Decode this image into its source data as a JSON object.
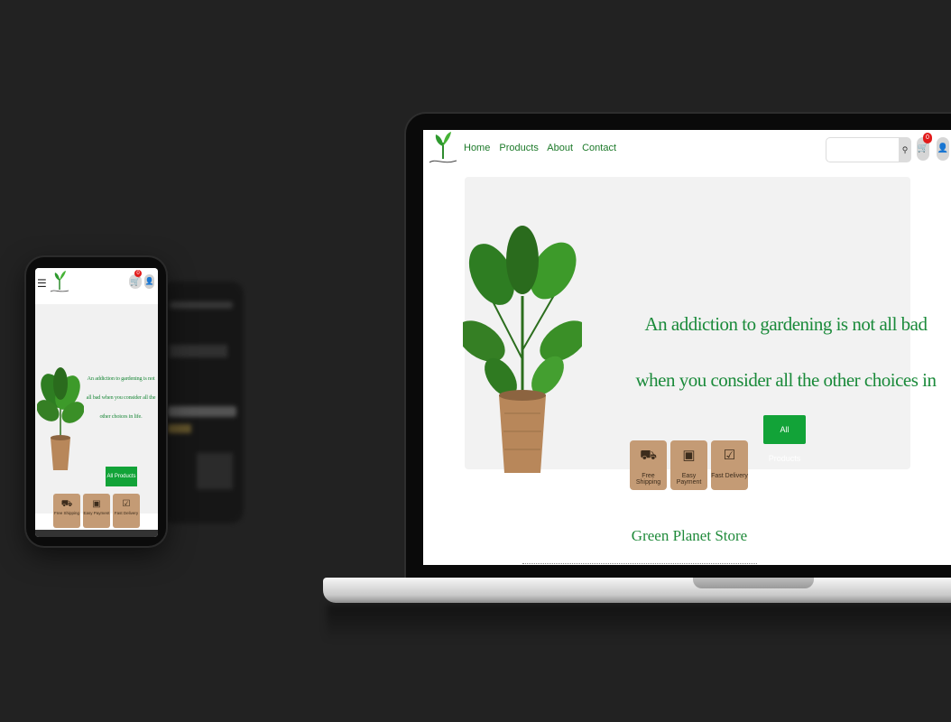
{
  "site": {
    "nav": [
      "Home",
      "Products",
      "About",
      "Contact"
    ],
    "search_placeholder": "",
    "cart_count": "0",
    "hero_quote": "An addiction to gardening is not all bad when you consider all the other choices in life.",
    "cta": "All Products",
    "features": [
      {
        "label": "Free Shipping",
        "icon": "truck-icon"
      },
      {
        "label": "Easy Payment",
        "icon": "wallet-icon"
      },
      {
        "label": "Fast Delivery",
        "icon": "clipboard-check-icon"
      }
    ],
    "store_title": "Green Planet Store"
  },
  "mobile": {
    "menu_icon": "hamburger-icon",
    "cart_count": "0",
    "hero_quote": "An addiction to gardening is not all bad when you consider all the other choices in life.",
    "cta": "All Products",
    "features": [
      {
        "label": "Free Shipping"
      },
      {
        "label": "Easy Payment"
      },
      {
        "label": "Fast Delivery"
      }
    ]
  },
  "colors": {
    "background": "#222222",
    "brand_green": "#1a8a3a",
    "button_green": "#12a338",
    "feature_tan": "#c49b75",
    "badge_red": "#e21c1c"
  }
}
